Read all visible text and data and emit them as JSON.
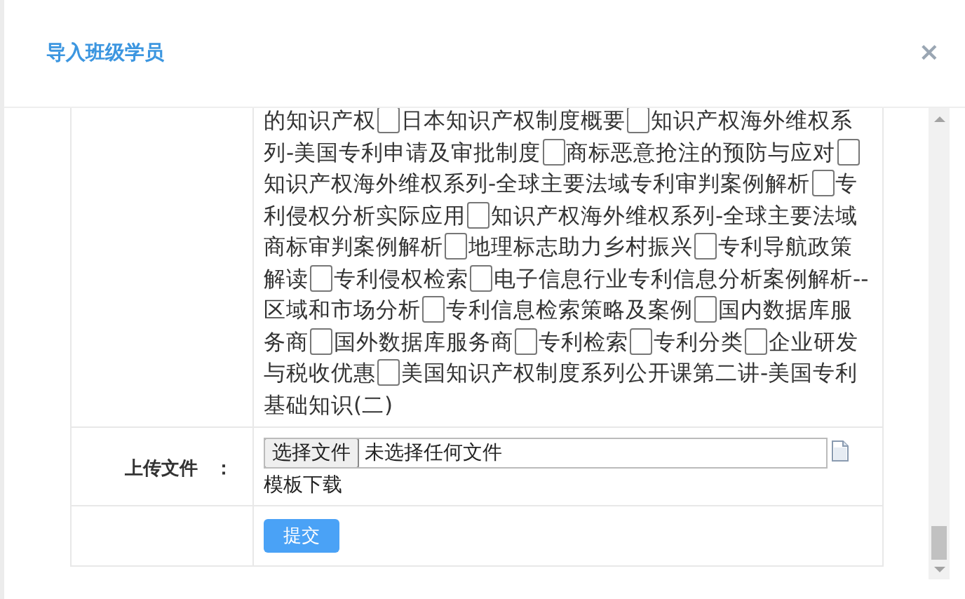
{
  "dialog": {
    "title": "导入班级学员",
    "close": "×"
  },
  "course_row": {
    "courses": [
      {
        "kind": "tail",
        "name": "的知识产权"
      },
      {
        "kind": "option",
        "name": "日本知识产权制度概要",
        "checked": false
      },
      {
        "kind": "option",
        "name": "知识产权海外维权系列-美国专利申请及审批制度",
        "checked": false
      },
      {
        "kind": "option",
        "name": "商标恶意抢注的预防与应对",
        "checked": false
      },
      {
        "kind": "option",
        "name": "知识产权海外维权系列-全球主要法域专利审判案例解析",
        "checked": false
      },
      {
        "kind": "option",
        "name": "专利侵权分析实际应用",
        "checked": false
      },
      {
        "kind": "option",
        "name": "知识产权海外维权系列-全球主要法域商标审判案例解析",
        "checked": false
      },
      {
        "kind": "option",
        "name": "地理标志助力乡村振兴",
        "checked": false
      },
      {
        "kind": "option",
        "name": "专利导航政策解读",
        "checked": false
      },
      {
        "kind": "option",
        "name": "专利侵权检索",
        "checked": false
      },
      {
        "kind": "option",
        "name": "电子信息行业专利信息分析案例解析--区域和市场分析",
        "checked": false
      },
      {
        "kind": "option",
        "name": "专利信息检索策略及案例",
        "checked": false
      },
      {
        "kind": "option",
        "name": "国内数据库服务商",
        "checked": false
      },
      {
        "kind": "option",
        "name": "国外数据库服务商",
        "checked": false
      },
      {
        "kind": "option",
        "name": "专利检索",
        "checked": false
      },
      {
        "kind": "option",
        "name": "专利分类",
        "checked": false
      },
      {
        "kind": "option",
        "name": "企业研发与税收优惠",
        "checked": false
      },
      {
        "kind": "option",
        "name": "美国知识产权制度系列公开课第二讲-美国专利基础知识(二)",
        "checked": false
      }
    ]
  },
  "upload_row": {
    "label": "上传文件",
    "colon": "：",
    "choose_button": "选择文件",
    "file_status": "未选择任何文件",
    "template_link": "模板下载"
  },
  "submit_button": "提交"
}
